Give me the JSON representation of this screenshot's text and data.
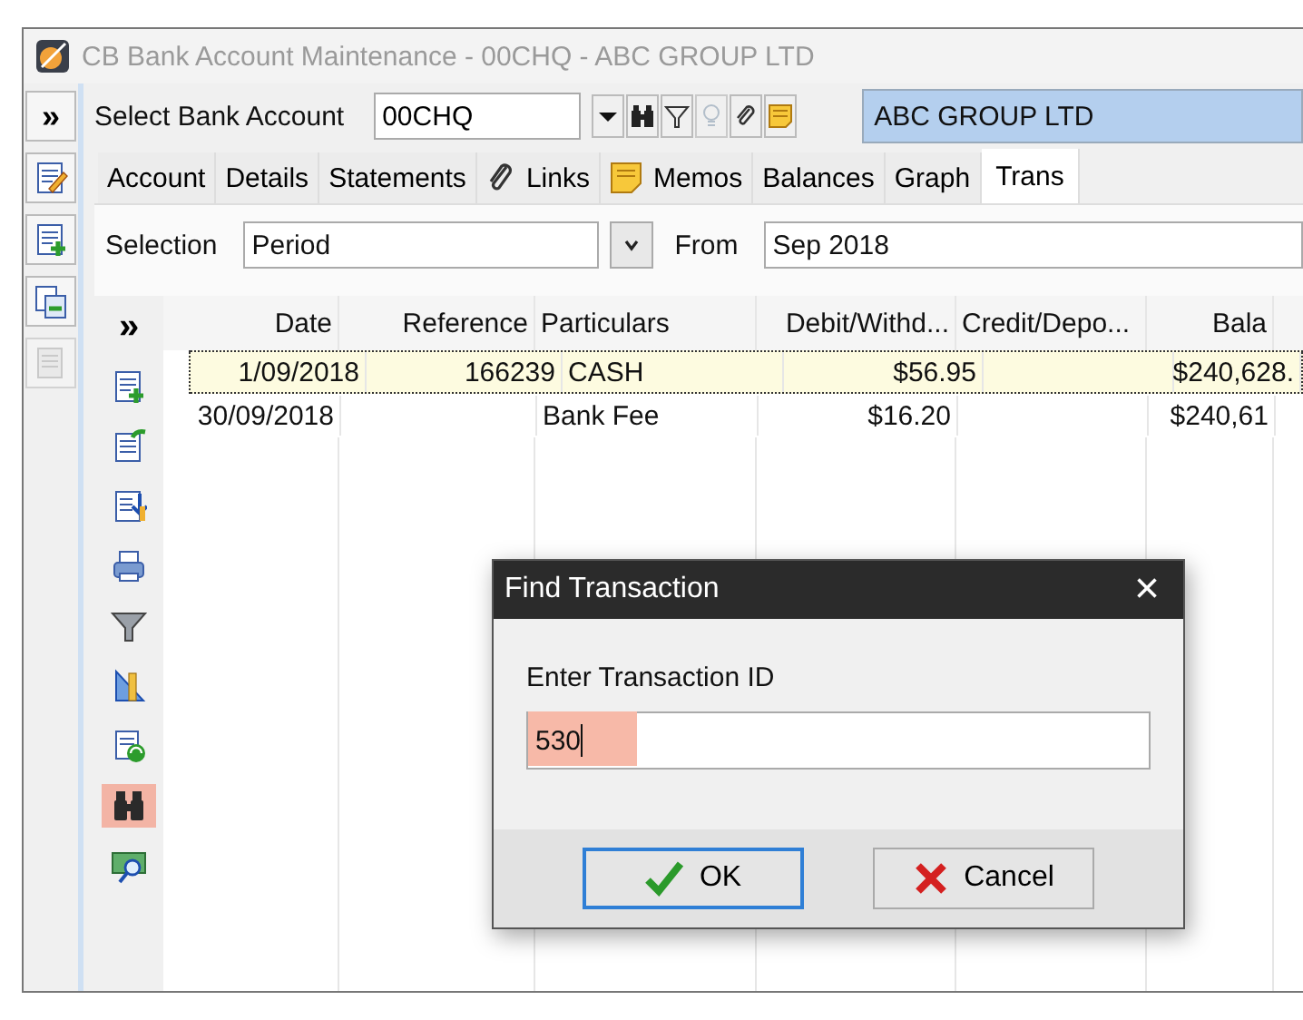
{
  "window": {
    "title": "CB Bank Account Maintenance - 00CHQ - ABC GROUP LTD"
  },
  "left_toolbar": [
    {
      "kind": "edit",
      "disabled": false
    },
    {
      "kind": "add",
      "disabled": false
    },
    {
      "kind": "copy",
      "disabled": false
    },
    {
      "kind": "page",
      "disabled": true
    }
  ],
  "account_bar": {
    "expand": "»",
    "label": "Select Bank Account",
    "value": "00CHQ",
    "company": "ABC GROUP LTD",
    "tools": [
      {
        "kind": "dropdown",
        "disabled": false
      },
      {
        "kind": "binoculars",
        "disabled": false
      },
      {
        "kind": "filter",
        "disabled": false
      },
      {
        "kind": "bulb",
        "disabled": true
      },
      {
        "kind": "paperclip",
        "disabled": false
      },
      {
        "kind": "note",
        "disabled": false
      }
    ]
  },
  "tabs": [
    {
      "label": "Account",
      "kind": "text",
      "selected": false
    },
    {
      "label": "Details",
      "kind": "text",
      "selected": false
    },
    {
      "label": "Statements",
      "kind": "text",
      "selected": false
    },
    {
      "label": "Links",
      "kind": "paperclip",
      "selected": false
    },
    {
      "label": "Memos",
      "kind": "note",
      "selected": false
    },
    {
      "label": "Balances",
      "kind": "text",
      "selected": false
    },
    {
      "label": "Graph",
      "kind": "text",
      "selected": false
    },
    {
      "label": "Trans",
      "kind": "text",
      "selected": true
    }
  ],
  "selection": {
    "label": "Selection",
    "value": "Period",
    "from_label": "From",
    "from_value": "Sep 2018"
  },
  "grid": {
    "expand": "»",
    "columns": [
      {
        "label": "Date"
      },
      {
        "label": "Reference"
      },
      {
        "label": "Particulars"
      },
      {
        "label": "Debit/Withd..."
      },
      {
        "label": "Credit/Depo..."
      },
      {
        "label": "Bala"
      }
    ],
    "rows": [
      {
        "cells": [
          "1/09/2018",
          "166239",
          "CASH",
          "$56.95",
          "",
          "$240,628."
        ],
        "selected": true
      },
      {
        "cells": [
          "30/09/2018",
          "",
          "Bank Fee",
          "$16.20",
          "",
          "$240,61"
        ],
        "selected": false
      }
    ]
  },
  "side_tools": [
    {
      "kind": "add",
      "highlighted": false
    },
    {
      "kind": "export",
      "highlighted": false
    },
    {
      "kind": "import",
      "highlighted": false
    },
    {
      "kind": "print",
      "highlighted": false
    },
    {
      "kind": "filter",
      "highlighted": false
    },
    {
      "kind": "ruler",
      "highlighted": false
    },
    {
      "kind": "refresh",
      "highlighted": false
    },
    {
      "kind": "binoculars",
      "highlighted": true
    },
    {
      "kind": "money",
      "highlighted": false
    }
  ],
  "dialog": {
    "title": "Find Transaction",
    "close": "×",
    "label": "Enter Transaction ID",
    "value": "530",
    "highlighted": true,
    "buttons": [
      {
        "kind": "ok",
        "label": "OK",
        "default": true
      },
      {
        "kind": "cancel",
        "label": "Cancel",
        "default": false
      }
    ]
  }
}
